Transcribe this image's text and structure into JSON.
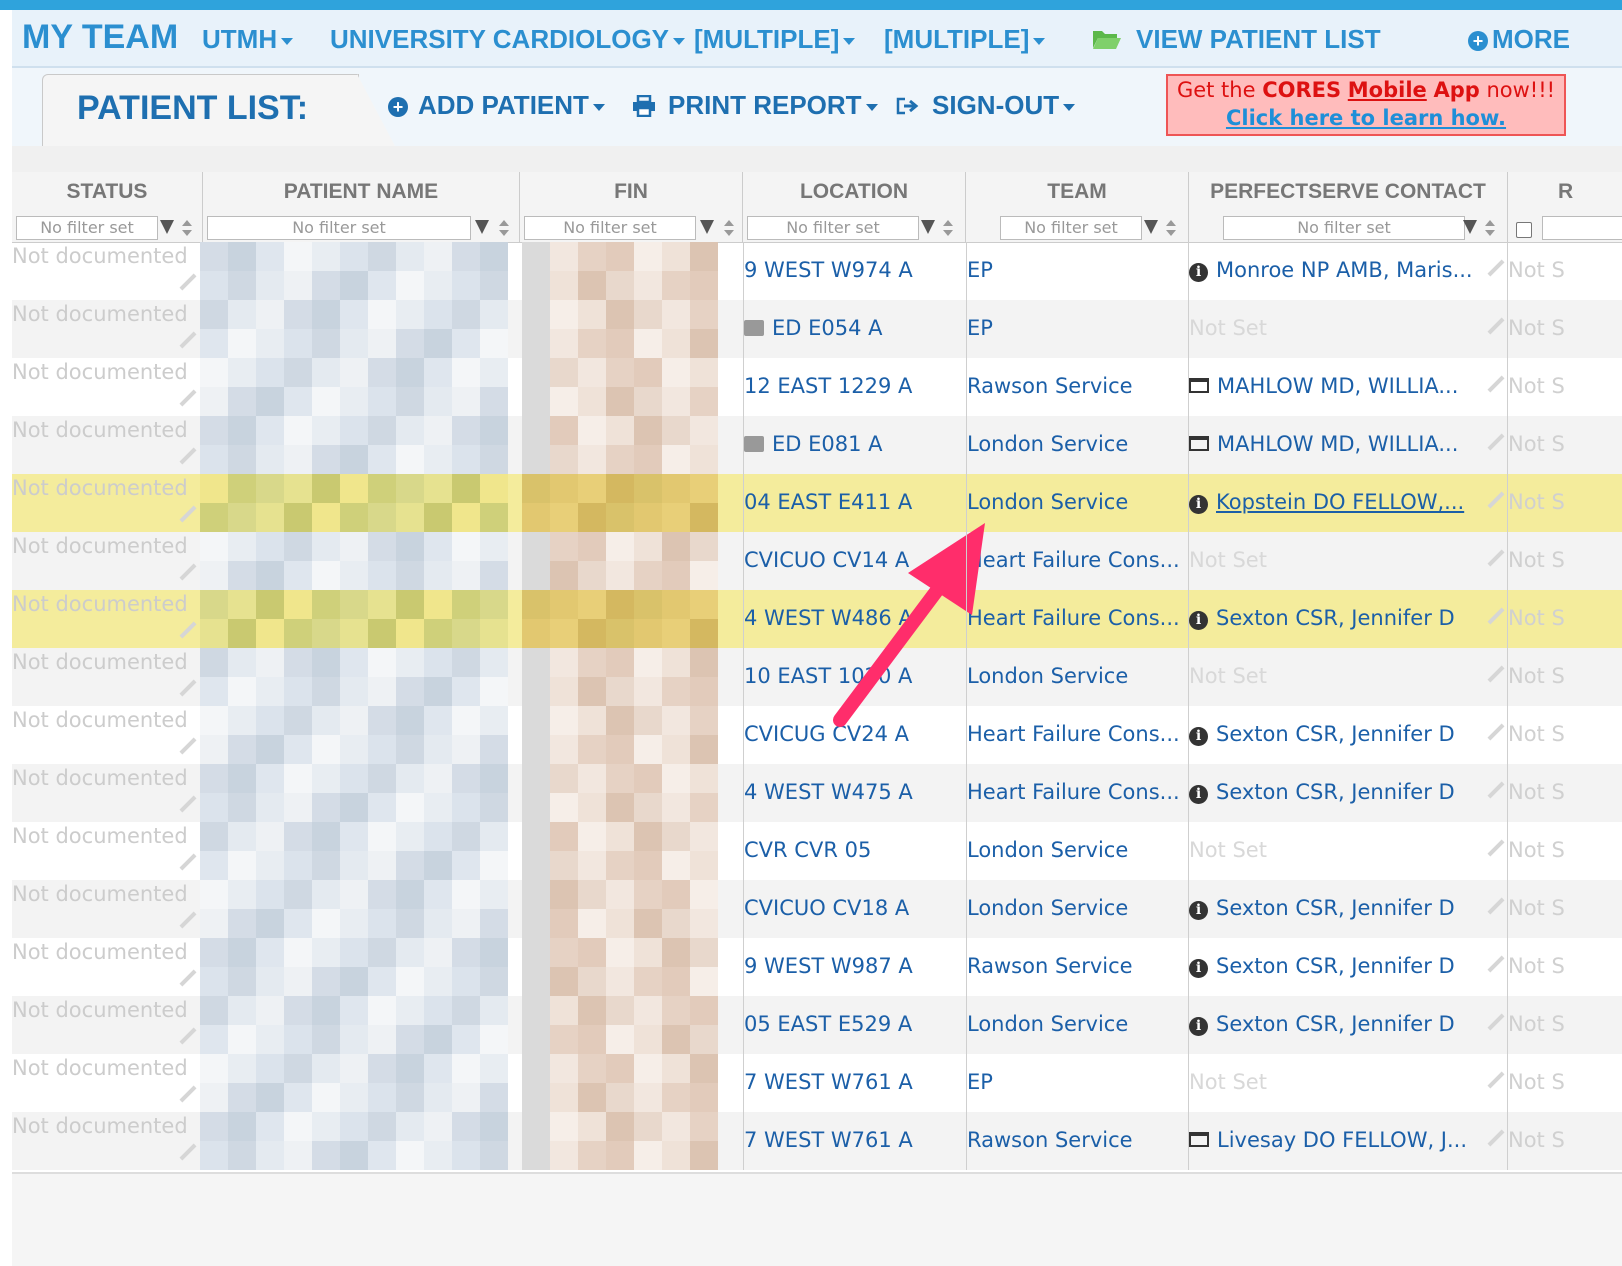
{
  "nav": {
    "title": "MY TEAM",
    "items": [
      "UTMH",
      "UNIVERSITY CARDIOLOGY",
      "[MULTIPLE]",
      "[MULTIPLE]"
    ],
    "view_patient_list": "VIEW PATIENT LIST",
    "more": "MORE"
  },
  "subnav": {
    "tab_label": "PATIENT LIST:",
    "add_patient": "ADD PATIENT",
    "print_report": "PRINT REPORT",
    "sign_out": "SIGN-OUT"
  },
  "promo": {
    "line1_prefix": "Get the ",
    "line1_brand": "CORES",
    "line1_mobile": "Mobile",
    "line1_app": "App",
    "line1_suffix": " now!!!",
    "line2": "Click here to learn how."
  },
  "table": {
    "headers": [
      "STATUS",
      "PATIENT NAME",
      "FIN",
      "LOCATION",
      "TEAM",
      "PERFECTSERVE CONTACT",
      "R"
    ],
    "filter_placeholder": "No filter set",
    "status_text": "Not documented",
    "not_set": "Not Set",
    "not_set_short": "Not S",
    "rows": [
      {
        "location": "9 WEST W974 A",
        "team": "EP",
        "contact": "Monroe NP AMB, Maris...",
        "contact_icon": "info-icon",
        "hl": false
      },
      {
        "location": "ED E054 A",
        "team": "EP",
        "contact": "",
        "contact_icon": "",
        "hl": false,
        "amb": true
      },
      {
        "location": "12 EAST 1229 A",
        "team": "Rawson Service",
        "contact": "MAHLOW MD, WILLIA...",
        "contact_icon": "card-icon",
        "hl": false
      },
      {
        "location": "ED E081 A",
        "team": "London Service",
        "contact": "MAHLOW MD, WILLIA...",
        "contact_icon": "card-icon",
        "hl": false,
        "amb": true
      },
      {
        "location": "04 EAST E411 A",
        "team": "London Service",
        "contact": "Kopstein DO FELLOW,...",
        "contact_icon": "info-icon",
        "hl": true,
        "underline": true
      },
      {
        "location": "CVICUO CV14 A",
        "team": "Heart Failure Cons...",
        "contact": "",
        "contact_icon": "",
        "hl": false
      },
      {
        "location": "4 WEST W486 A",
        "team": "Heart Failure Cons...",
        "contact": "Sexton CSR, Jennifer D",
        "contact_icon": "info-icon",
        "hl": true
      },
      {
        "location": "10 EAST 1020 A",
        "team": "London Service",
        "contact": "",
        "contact_icon": "",
        "hl": false
      },
      {
        "location": "CVICUG CV24 A",
        "team": "Heart Failure Cons...",
        "contact": "Sexton CSR, Jennifer D",
        "contact_icon": "info-icon",
        "hl": false
      },
      {
        "location": "4 WEST W475 A",
        "team": "Heart Failure Cons...",
        "contact": "Sexton CSR, Jennifer D",
        "contact_icon": "info-icon",
        "hl": false
      },
      {
        "location": "CVR CVR 05",
        "team": "London Service",
        "contact": "",
        "contact_icon": "",
        "hl": false
      },
      {
        "location": "CVICUO CV18 A",
        "team": "London Service",
        "contact": "Sexton CSR, Jennifer D",
        "contact_icon": "info-icon",
        "hl": false
      },
      {
        "location": "9 WEST W987 A",
        "team": "Rawson Service",
        "contact": "Sexton CSR, Jennifer D",
        "contact_icon": "info-icon",
        "hl": false
      },
      {
        "location": "05 EAST E529 A",
        "team": "London Service",
        "contact": "Sexton CSR, Jennifer D",
        "contact_icon": "info-icon",
        "hl": false
      },
      {
        "location": "7 WEST W761 A",
        "team": "EP",
        "contact": "",
        "contact_icon": "",
        "hl": false
      },
      {
        "location": "7 WEST W761 A",
        "team": "Rawson Service",
        "contact": "Livesay DO FELLOW, J...",
        "contact_icon": "card-icon",
        "hl": false
      }
    ]
  },
  "colors": {
    "accent": "#2b8fd0",
    "highlight_row": "#f4ec9c",
    "annotation_arrow": "#ff2d6b"
  }
}
